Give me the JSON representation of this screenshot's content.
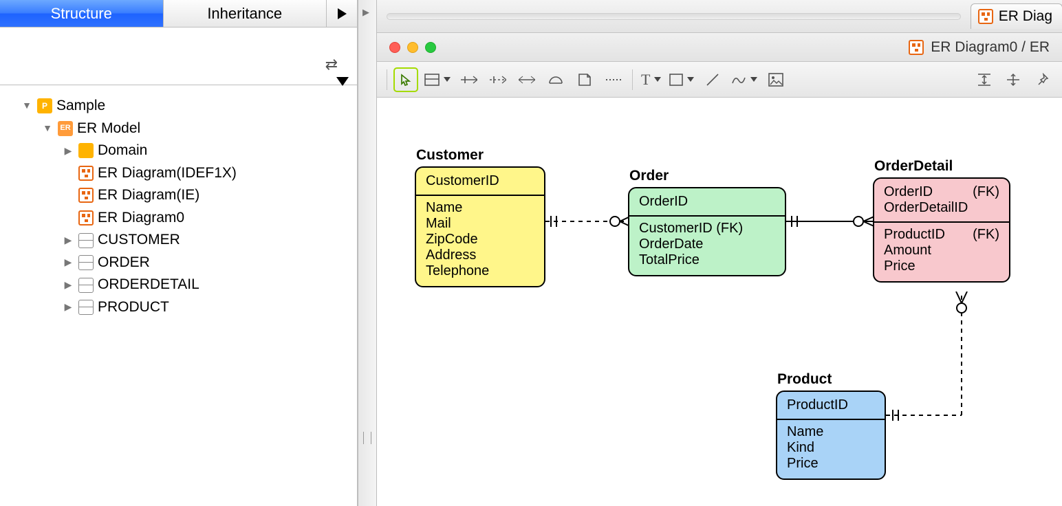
{
  "tabs": {
    "structure": "Structure",
    "inheritance": "Inheritance"
  },
  "tree": {
    "root": "Sample",
    "model": "ER Model",
    "domain": "Domain",
    "diag1": "ER Diagram(IDEF1X)",
    "diag2": "ER Diagram(IE)",
    "diag3": "ER Diagram0",
    "t1": "CUSTOMER",
    "t2": "ORDER",
    "t3": "ORDERDETAIL",
    "t4": "PRODUCT"
  },
  "doc_tab": "ER Diag",
  "window_title": "ER Diagram0 / ER",
  "entities": {
    "customer": {
      "title": "Customer",
      "pk": "CustomerID",
      "a1": "Name",
      "a2": "Mail",
      "a3": "ZipCode",
      "a4": "Address",
      "a5": "Telephone"
    },
    "order": {
      "title": "Order",
      "pk": "OrderID",
      "a1": "CustomerID (FK)",
      "a2": "OrderDate",
      "a3": "TotalPrice"
    },
    "detail": {
      "title": "OrderDetail",
      "pk1": "OrderID",
      "pk1fk": "(FK)",
      "pk2": "OrderDetailID",
      "a1": "ProductID",
      "a1fk": "(FK)",
      "a2": "Amount",
      "a3": "Price"
    },
    "product": {
      "title": "Product",
      "pk": "ProductID",
      "a1": "Name",
      "a2": "Kind",
      "a3": "Price"
    }
  }
}
